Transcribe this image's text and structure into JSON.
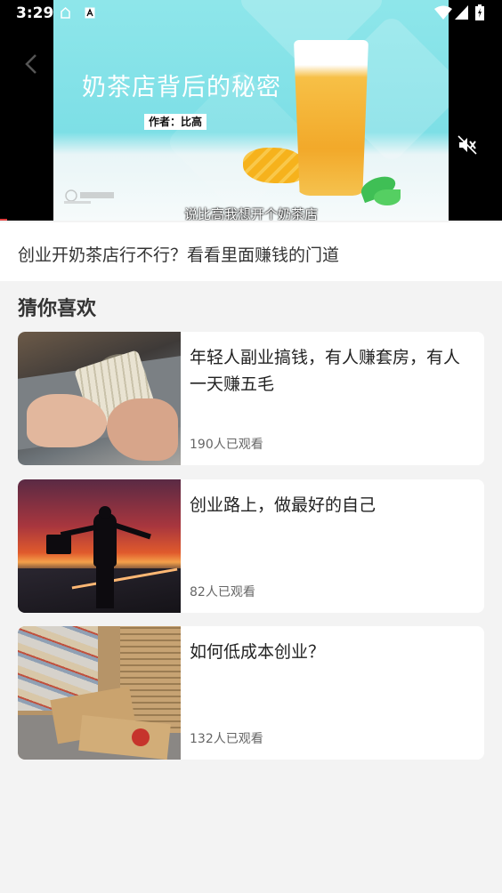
{
  "status_bar": {
    "time": "3:29"
  },
  "video": {
    "thumbnail_title": "奶茶店背后的秘密",
    "thumbnail_author": "作者：比高",
    "subtitle": "说比高我想开个奶茶店",
    "watermark": "",
    "progress_fraction": 0.015
  },
  "video_title": "创业开奶茶店行不行？看看里面赚钱的门道",
  "recommend": {
    "section_title": "猜你喜欢",
    "items": [
      {
        "headline": "年轻人副业搞钱，有人赚套房，有人一天赚五毛",
        "views": "190人已观看"
      },
      {
        "headline": "创业路上，做最好的自己",
        "views": "82人已观看"
      },
      {
        "headline": "如何低成本创业？",
        "views": "132人已观看"
      }
    ]
  },
  "colors": {
    "page_bg": "#f3f3f3",
    "card_bg": "#ffffff",
    "accent_progress": "#e04040"
  },
  "icons": {
    "back": "back-arrow-icon",
    "mute": "volume-mute-icon",
    "wifi": "wifi-icon",
    "cell": "cell-signal-icon",
    "battery": "battery-icon"
  }
}
